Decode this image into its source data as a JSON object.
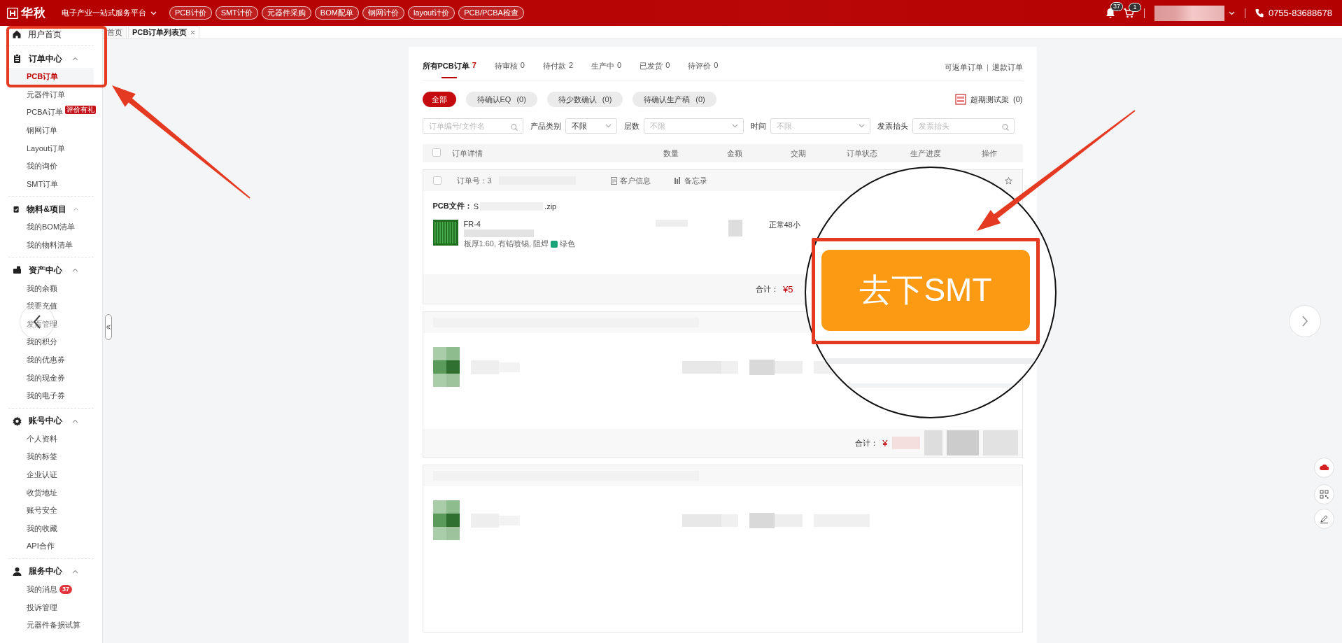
{
  "topbar": {
    "logo": "华秋",
    "platform": "电子产业一站式服务平台",
    "nav": [
      "PCB计价",
      "SMT计价",
      "元器件采购",
      "BOM配单",
      "钢网计价",
      "layout计价",
      "PCB/PCBA检查"
    ],
    "notifications": "37",
    "cart": "1",
    "phone": "0755-83688678"
  },
  "page_tabs": [
    {
      "label": "首页",
      "selected": false
    },
    {
      "label": "PCB订单列表页",
      "selected": true
    }
  ],
  "sidebar": {
    "home": "用户首页",
    "sections": [
      {
        "title": "订单中心",
        "expanded": true,
        "items": [
          {
            "label": "PCB订单",
            "selected": true
          },
          {
            "label": "元器件订单",
            "selected": false
          },
          {
            "label": "PCBA订单",
            "selected": false,
            "badge": {
              "kind": "tag",
              "text": "评价有礼"
            }
          },
          {
            "label": "钢网订单",
            "selected": false
          },
          {
            "label": "Layout订单",
            "selected": false
          },
          {
            "label": "我的询价",
            "selected": false
          },
          {
            "label": "SMT订单",
            "selected": false
          }
        ]
      },
      {
        "title": "物料&项目",
        "expanded": true,
        "items": [
          {
            "label": "我的BOM清单",
            "selected": false
          },
          {
            "label": "我的物料清单",
            "selected": false
          }
        ]
      },
      {
        "title": "资产中心",
        "expanded": true,
        "items": [
          {
            "label": "我的余额",
            "selected": false
          },
          {
            "label": "我要充值",
            "selected": false
          },
          {
            "label": "发票管理",
            "selected": false
          },
          {
            "label": "我的积分",
            "selected": false
          },
          {
            "label": "我的优惠券",
            "selected": false
          },
          {
            "label": "我的现金券",
            "selected": false
          },
          {
            "label": "我的电子券",
            "selected": false
          }
        ]
      },
      {
        "title": "账号中心",
        "expanded": true,
        "items": [
          {
            "label": "个人资料",
            "selected": false
          },
          {
            "label": "我的标签",
            "selected": false
          },
          {
            "label": "企业认证",
            "selected": false
          },
          {
            "label": "收货地址",
            "selected": false
          },
          {
            "label": "账号安全",
            "selected": false
          },
          {
            "label": "我的收藏",
            "selected": false
          },
          {
            "label": "API合作",
            "selected": false
          }
        ]
      },
      {
        "title": "服务中心",
        "expanded": true,
        "items": [
          {
            "label": "我的消息",
            "selected": false,
            "badge": {
              "kind": "count",
              "text": "37"
            }
          },
          {
            "label": "投诉管理",
            "selected": false
          },
          {
            "label": "元器件备损试算",
            "selected": false
          }
        ]
      }
    ]
  },
  "orders_panel": {
    "status_tabs": [
      {
        "label": "所有PCB订单",
        "count": "7",
        "selected": true
      },
      {
        "label": "待审核",
        "count": "0",
        "selected": false
      },
      {
        "label": "待付款",
        "count": "2",
        "selected": false
      },
      {
        "label": "生产中",
        "count": "0",
        "selected": false
      },
      {
        "label": "已发货",
        "count": "0",
        "selected": false
      },
      {
        "label": "待评价",
        "count": "0",
        "selected": false
      }
    ],
    "links": [
      "可返单订单",
      "退款订单"
    ],
    "chips": [
      {
        "label": "全部",
        "selected": true
      },
      {
        "label": "待确认EQ",
        "count": "(0)",
        "selected": false
      },
      {
        "label": "待少数确认",
        "count": "(0)",
        "selected": false
      },
      {
        "label": "待确认生产稿",
        "count": "(0)",
        "selected": false
      }
    ],
    "overdue": {
      "label": "超期测试架",
      "count": "(0)"
    },
    "filters": {
      "search": {
        "placeholder": "订单编号/文件名"
      },
      "dropdowns": [
        {
          "label": "产品类别",
          "value": "不限"
        },
        {
          "label": "层数",
          "placeholder": "不限"
        },
        {
          "label": "时间",
          "placeholder": "不限"
        }
      ],
      "invoice": {
        "label": "发票抬头",
        "placeholder": "发票抬头"
      }
    },
    "table": {
      "checked": false,
      "columns": [
        "订单详情",
        "数量",
        "金额",
        "交期",
        "订单状态",
        "生产进度",
        "操作"
      ]
    },
    "orders": [
      {
        "kind": "detailed",
        "checked": false,
        "starred": false,
        "order_label": "订单号：",
        "order_no_start": "3",
        "customer_info": "客户信息",
        "memo": "备忘录",
        "file_label": "PCB文件：",
        "file_start": "S",
        "file_end": ".zip",
        "material": "FR-4",
        "spec": "板厚1.60, 有铅喷锡, 阻焊",
        "mask": {
          "label": "绿色",
          "color": "#1aa37a"
        },
        "delivery": "正常48小",
        "total_label": "合计：",
        "total": "¥5"
      },
      {
        "kind": "pixelated",
        "total_label": "合计：",
        "total": "¥"
      },
      {
        "kind": "pixelated"
      }
    ]
  },
  "annotation": {
    "callout_button": "去下SMT"
  }
}
